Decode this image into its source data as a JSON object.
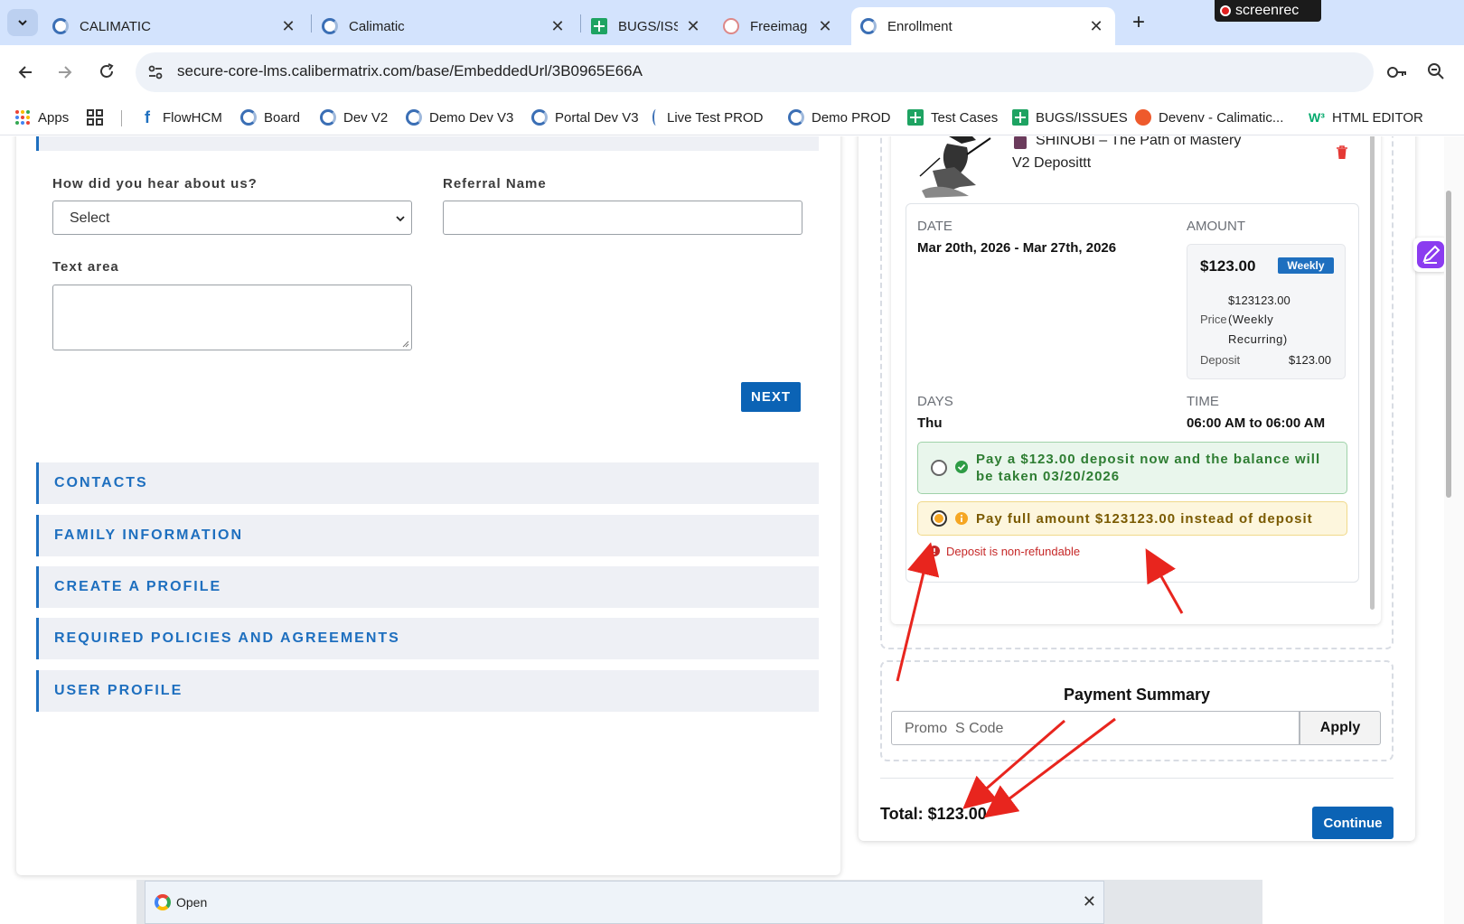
{
  "browser": {
    "tabs": [
      {
        "title": "CALIMATIC",
        "icon": "calimatic-icon",
        "active": false
      },
      {
        "title": "Calimatic",
        "icon": "calimatic-icon",
        "active": false
      },
      {
        "title": "BUGS/ISS",
        "icon": "sheets-icon",
        "active": false
      },
      {
        "title": "Freeimag",
        "icon": "freeimage-icon",
        "active": false
      },
      {
        "title": "Enrollment",
        "icon": "calimatic-icon",
        "active": true
      }
    ],
    "new_tab": "+",
    "recorder_label": "screenrec",
    "url": "secure-core-lms.calibermatrix.com/base/EmbeddedUrl/3B0965E66A",
    "bookmarks": [
      {
        "label": "Apps",
        "icon": "apps-grid-icon"
      },
      {
        "label": "",
        "icon": "tab-groups-icon"
      },
      {
        "label": "FlowHCM",
        "icon": "flowhcm-icon"
      },
      {
        "label": "Board",
        "icon": "calimatic-icon"
      },
      {
        "label": "Dev V2",
        "icon": "calimatic-icon"
      },
      {
        "label": "Demo Dev V3",
        "icon": "calimatic-icon"
      },
      {
        "label": "Portal Dev V3",
        "icon": "calimatic-icon"
      },
      {
        "label": "Live Test PROD",
        "icon": "partial-icon"
      },
      {
        "label": "Demo PROD",
        "icon": "calimatic-icon"
      },
      {
        "label": "Test Cases",
        "icon": "sheets-icon"
      },
      {
        "label": "BUGS/ISSUES",
        "icon": "sheets-icon"
      },
      {
        "label": "Devenv - Calimatic...",
        "icon": "devenv-icon"
      },
      {
        "label": "HTML EDITOR",
        "icon": "w3-icon"
      }
    ]
  },
  "form": {
    "heard_label": "How did you hear about us?",
    "heard_value": "Select",
    "referral_label": "Referral Name",
    "referral_value": "",
    "textarea_label": "Text area",
    "next_label": "NEXT",
    "sections": [
      "CONTACTS",
      "FAMILY INFORMATION",
      "CREATE A PROFILE",
      "REQUIRED POLICIES AND AGREEMENTS",
      "USER PROFILE"
    ]
  },
  "cart": {
    "item_title": "SHINOBI – The Path of Mastery",
    "item_subtitle": "V2 Deposittt",
    "date_label": "DATE",
    "date_value": "Mar 20th, 2026 - Mar 27th, 2026",
    "amount_label": "AMOUNT",
    "amount_value": "$123.00",
    "frequency_badge": "Weekly",
    "price_value": "$123123.00",
    "price_label": "Price",
    "price_frequency_1": "(Weekly",
    "price_frequency_2": "Recurring)",
    "deposit_label": "Deposit",
    "deposit_value": "$123.00",
    "days_label": "DAYS",
    "days_value": "Thu",
    "time_label": "TIME",
    "time_value": "06:00 AM to 06:00 AM",
    "option_deposit_line1": "Pay a $123.00 deposit now and the balance will",
    "option_deposit_line2": "be taken 03/20/2026",
    "option_full": "Pay full amount $123123.00 instead of deposit",
    "selected_option": "full",
    "nonrefundable": "Deposit is non-refundable"
  },
  "summary": {
    "title": "Payment Summary",
    "promo_placeholder": "Promo  S Code",
    "apply_label": "Apply",
    "total": "Total: $123.00",
    "continue_label": "Continue"
  },
  "download_bar": {
    "label": "Open"
  },
  "colors": {
    "primary": "#0b63b5",
    "section_text": "#1e6fbf",
    "deposit_option_bg": "#e9f6ec",
    "full_option_bg": "#fdf6dd",
    "error": "#c62828",
    "annotation": "#e8251e"
  }
}
